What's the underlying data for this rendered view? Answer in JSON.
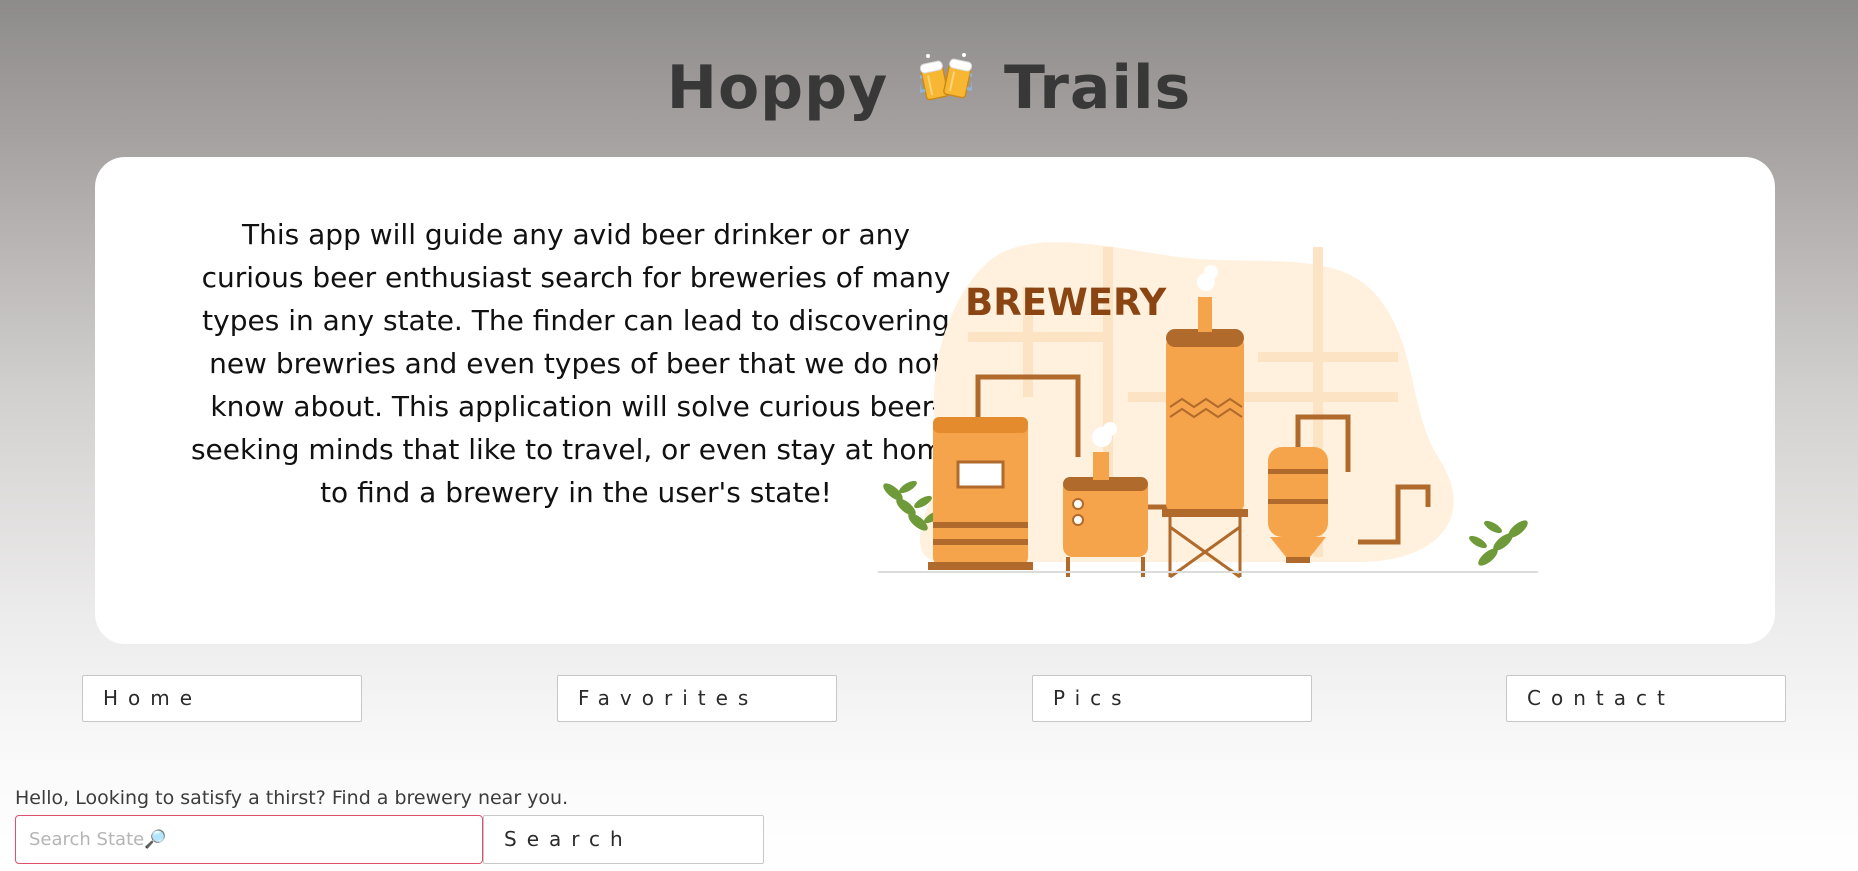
{
  "header": {
    "title_left": "Hoppy",
    "title_icon": "beer-mugs-icon",
    "title_right": "Trails"
  },
  "hero": {
    "description": "This app will guide any avid beer drinker or any curious beer enthusiast search for breweries of many types in any state. The finder can lead to discovering new brewries and even types of beer that we do not know about. This application will solve curious beer-seeking minds that like to travel, or even stay at home to find a brewery in the user's state!",
    "illustration_label": "BREWERY"
  },
  "nav": {
    "items": [
      {
        "label": "Home"
      },
      {
        "label": "Favorites"
      },
      {
        "label": "Pics"
      },
      {
        "label": "Contact"
      }
    ]
  },
  "search": {
    "greeting": "Hello, Looking to satisfy a thirst? Find a brewery near you.",
    "placeholder": "Search State🔎",
    "value": "",
    "button_label": "Search"
  },
  "colors": {
    "title": "#383838",
    "input_border": "#e0506e",
    "brewery_text": "#8b4513",
    "tank": "#f6a44c"
  }
}
